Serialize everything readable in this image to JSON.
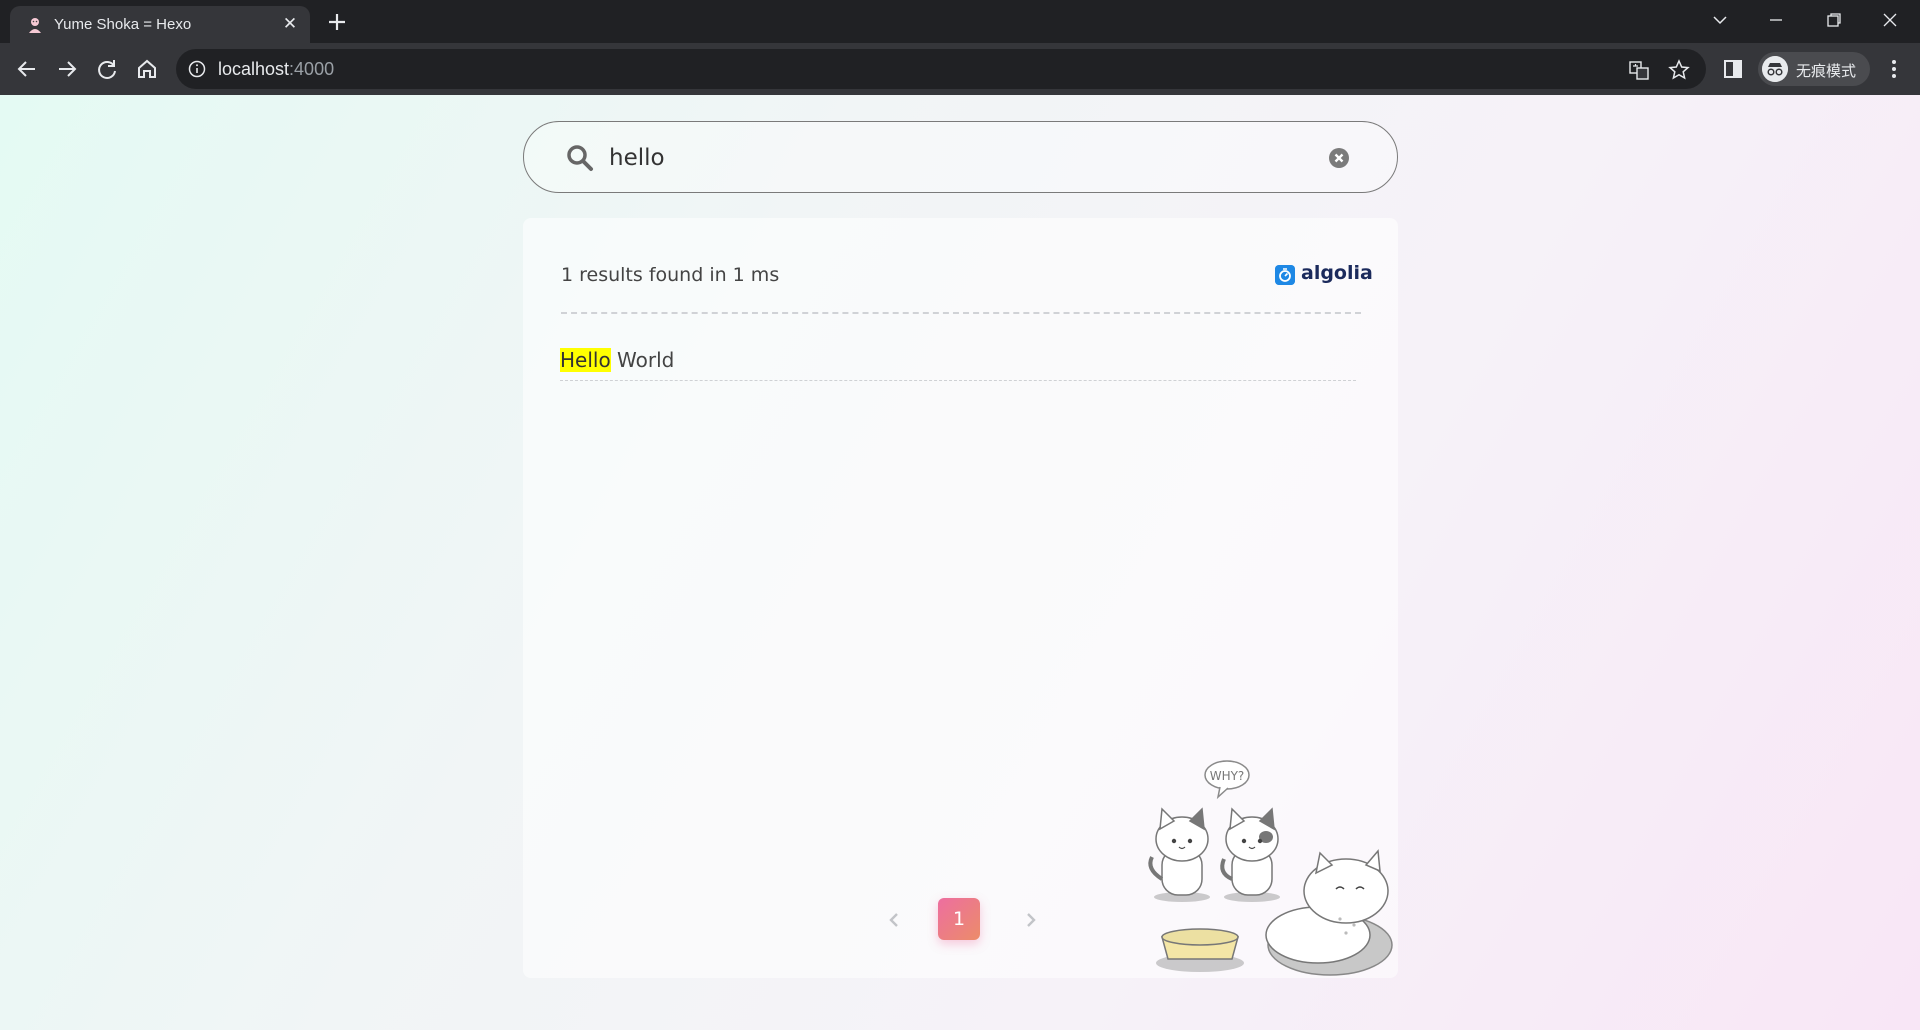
{
  "browser": {
    "tab": {
      "title": "Yume Shoka = Hexo",
      "close": "✕"
    },
    "address": {
      "host": "localhost",
      "port": ":4000"
    },
    "profile": {
      "label": "无痕模式"
    }
  },
  "search": {
    "query": "hello"
  },
  "results": {
    "stats": "1 results found in 1 ms",
    "provider": "algolia",
    "hits": [
      {
        "highlight": "Hello",
        "rest": " World"
      }
    ]
  },
  "pagination": {
    "current": "1"
  },
  "illustration": {
    "speech": "WHY?"
  }
}
